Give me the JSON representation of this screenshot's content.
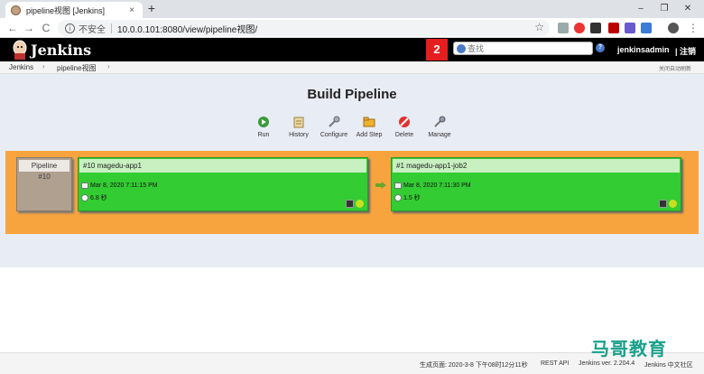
{
  "browser": {
    "tab_title": "pipeline视图 [Jenkins]",
    "tab_close": "×",
    "new_tab": "+",
    "insecure_label": "不安全",
    "url": "10.0.0.101:8080/view/pipeline视图/",
    "nav_back": "←",
    "nav_forward": "→",
    "nav_reload": "C",
    "star": "☆",
    "menu": "⋮",
    "win_min": "–",
    "win_max": "❐",
    "win_close": "✕"
  },
  "header": {
    "title": "Jenkins",
    "badge_count": "2",
    "search_placeholder": "查找",
    "help": "?",
    "username": "jenkinsadmin",
    "logout": "| 注销"
  },
  "breadcrumb": {
    "items": [
      "Jenkins",
      "pipeline视图"
    ],
    "arrow": "›",
    "right_link": "关闭自动刷新"
  },
  "main": {
    "title": "Build Pipeline",
    "actions": [
      {
        "label": "Run",
        "icon": "run-icon"
      },
      {
        "label": "History",
        "icon": "history-icon"
      },
      {
        "label": "Configure",
        "icon": "configure-icon"
      },
      {
        "label": "Add Step",
        "icon": "add-step-icon"
      },
      {
        "label": "Delete",
        "icon": "delete-icon"
      },
      {
        "label": "Manage",
        "icon": "manage-icon"
      }
    ],
    "pipeline": {
      "label": "Pipeline",
      "number": "#10"
    },
    "builds": [
      {
        "title": "#10 magedu-app1",
        "time": "Mar 8, 2020 7:11:15 PM",
        "duration": "6.8 秒"
      },
      {
        "title": "#1 magedu-app1-job2",
        "time": "Mar 8, 2020 7:11:30 PM",
        "duration": "1.5 秒"
      }
    ]
  },
  "footer": {
    "generated": "生成页面: 2020-3-8 下午08时12分11秒",
    "rest_api": "REST API",
    "version": "Jenkins ver. 2.204.4",
    "community": "Jenkins 中文社区"
  },
  "watermark": "马哥教育",
  "colors": {
    "band": "#f8a43e",
    "build_success": "#33cc33",
    "header_bg": "#000000",
    "badge": "#e41e1e"
  }
}
